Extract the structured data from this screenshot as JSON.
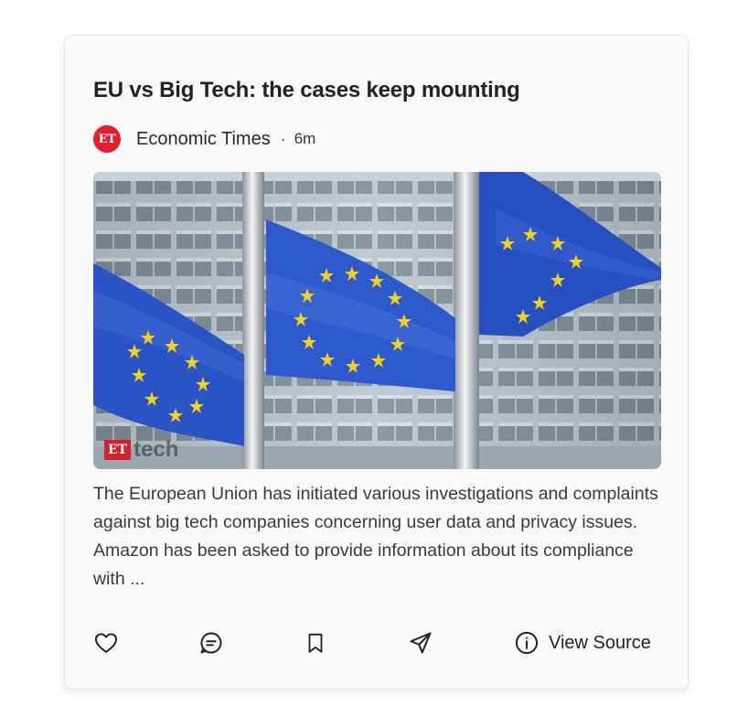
{
  "article": {
    "title": "EU vs Big Tech: the cases keep mounting",
    "source_logo_text": "ET",
    "source_name": "Economic Times",
    "separator": "·",
    "time_ago": "6m",
    "image_watermark": {
      "badge": "ET",
      "text": "tech"
    },
    "excerpt": "The European Union has initiated various investigations and complaints against big tech companies concerning user data and privacy issues. Amazon has been asked to provide information about its compliance with ..."
  },
  "actions": {
    "like_icon": "heart-icon",
    "comment_icon": "comment-icon",
    "bookmark_icon": "bookmark-icon",
    "share_icon": "send-icon",
    "view_source_icon": "info-icon",
    "view_source_label": "View Source"
  },
  "colors": {
    "brand_red": "#e2202c",
    "eu_blue": "#2a54c4",
    "eu_star": "#f5d21a"
  }
}
